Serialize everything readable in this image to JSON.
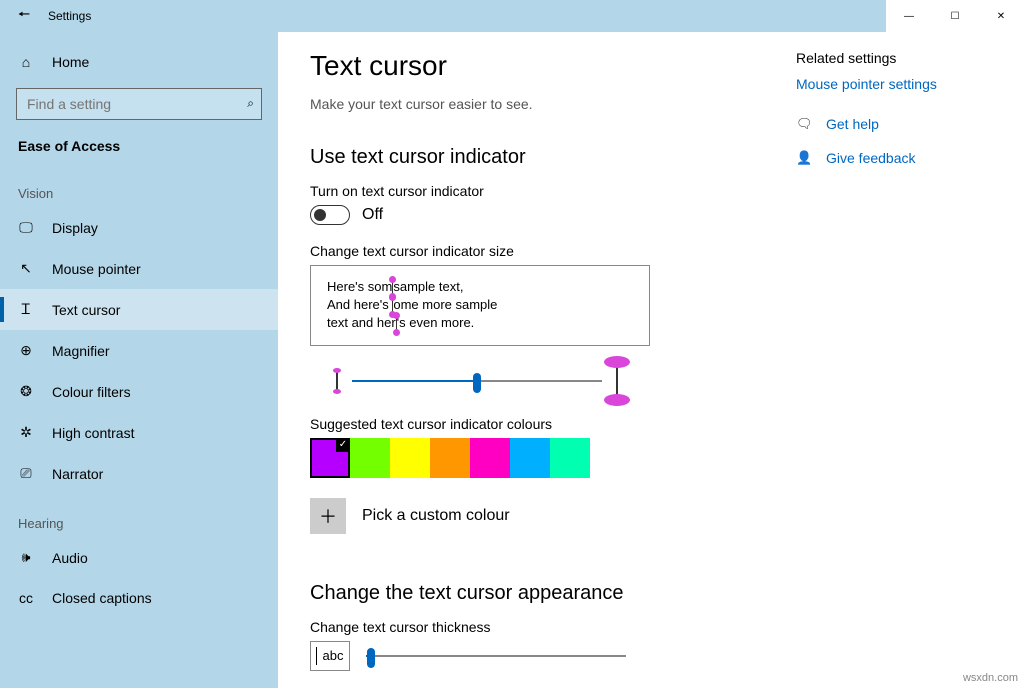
{
  "window": {
    "title": "Settings"
  },
  "sidebar": {
    "home": "Home",
    "search_placeholder": "Find a setting",
    "category": "Ease of Access",
    "groups": [
      {
        "label": "Vision",
        "items": [
          {
            "icon": "🖵",
            "label": "Display"
          },
          {
            "icon": "↖",
            "label": "Mouse pointer"
          },
          {
            "icon": "Ꮖ",
            "label": "Text cursor",
            "selected": true
          },
          {
            "icon": "⊕",
            "label": "Magnifier"
          },
          {
            "icon": "❂",
            "label": "Colour filters"
          },
          {
            "icon": "✲",
            "label": "High contrast"
          },
          {
            "icon": "⎚",
            "label": "Narrator"
          }
        ]
      },
      {
        "label": "Hearing",
        "items": [
          {
            "icon": "🕪",
            "label": "Audio"
          },
          {
            "icon": "cc",
            "label": "Closed captions"
          }
        ]
      }
    ]
  },
  "page": {
    "title": "Text cursor",
    "subtitle": "Make your text cursor easier to see.",
    "section_indicator": "Use text cursor indicator",
    "toggle_label": "Turn on text cursor indicator",
    "toggle_state": "Off",
    "size_label": "Change text cursor indicator size",
    "preview_line1a": "Here's som",
    "preview_line1b": "sample text,",
    "preview_line2a": "And here's ",
    "preview_line2b": "ome more sample",
    "preview_line3a": "text and her",
    "preview_line3b": "'s even more.",
    "colours_label": "Suggested text cursor indicator colours",
    "swatches": [
      "#b600ff",
      "#74ff00",
      "#ffff00",
      "#ff9800",
      "#ff00c3",
      "#00b0ff",
      "#00ffb0"
    ],
    "custom_label": "Pick a custom colour",
    "section_appearance": "Change the text cursor appearance",
    "thickness_label": "Change text cursor thickness",
    "thickness_preview": "abc"
  },
  "related": {
    "heading": "Related settings",
    "link": "Mouse pointer settings",
    "help": "Get help",
    "feedback": "Give feedback"
  },
  "watermark": "wsxdn.com"
}
